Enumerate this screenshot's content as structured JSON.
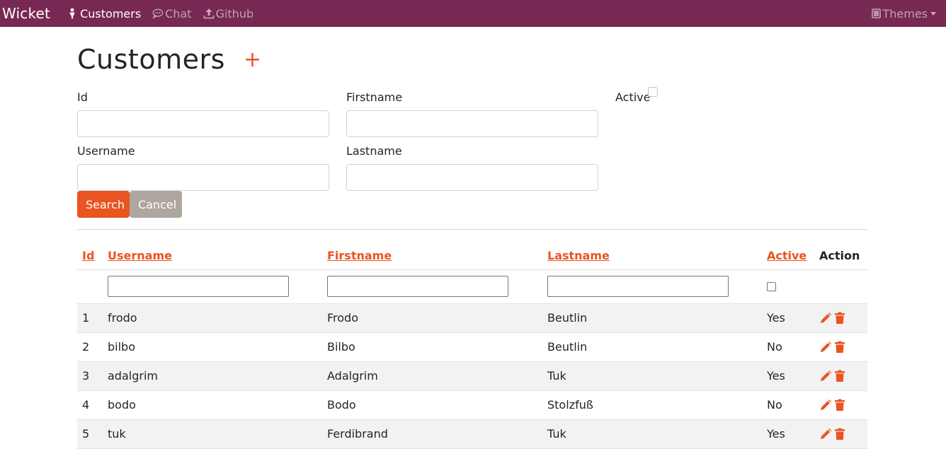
{
  "navbar": {
    "brand": "Wicket",
    "links": [
      {
        "label": "Customers",
        "icon": "person-icon"
      },
      {
        "label": "Chat",
        "icon": "chat-icon"
      },
      {
        "label": "Github",
        "icon": "upload-icon"
      }
    ],
    "themes_label": "Themes"
  },
  "page": {
    "title": "Customers",
    "add_symbol": "+"
  },
  "search_form": {
    "id_label": "Id",
    "firstname_label": "Firstname",
    "active_label": "Active",
    "username_label": "Username",
    "lastname_label": "Lastname",
    "id_value": "",
    "firstname_value": "",
    "username_value": "",
    "lastname_value": "",
    "search_button": "Search",
    "cancel_button": "Cancel"
  },
  "table": {
    "headers": {
      "id": "Id",
      "username": "Username",
      "firstname": "Firstname",
      "lastname": "Lastname",
      "active": "Active",
      "action": "Action"
    },
    "rows": [
      {
        "id": "1",
        "username": "frodo",
        "firstname": "Frodo",
        "lastname": "Beutlin",
        "active": "Yes"
      },
      {
        "id": "2",
        "username": "bilbo",
        "firstname": "Bilbo",
        "lastname": "Beutlin",
        "active": "No"
      },
      {
        "id": "3",
        "username": "adalgrim",
        "firstname": "Adalgrim",
        "lastname": "Tuk",
        "active": "Yes"
      },
      {
        "id": "4",
        "username": "bodo",
        "firstname": "Bodo",
        "lastname": "Stolzfuß",
        "active": "No"
      },
      {
        "id": "5",
        "username": "tuk",
        "firstname": "Ferdibrand",
        "lastname": "Tuk",
        "active": "Yes"
      }
    ]
  },
  "colors": {
    "navbar": "#772953",
    "accent": "#e95420",
    "cancel": "#aea79f"
  }
}
